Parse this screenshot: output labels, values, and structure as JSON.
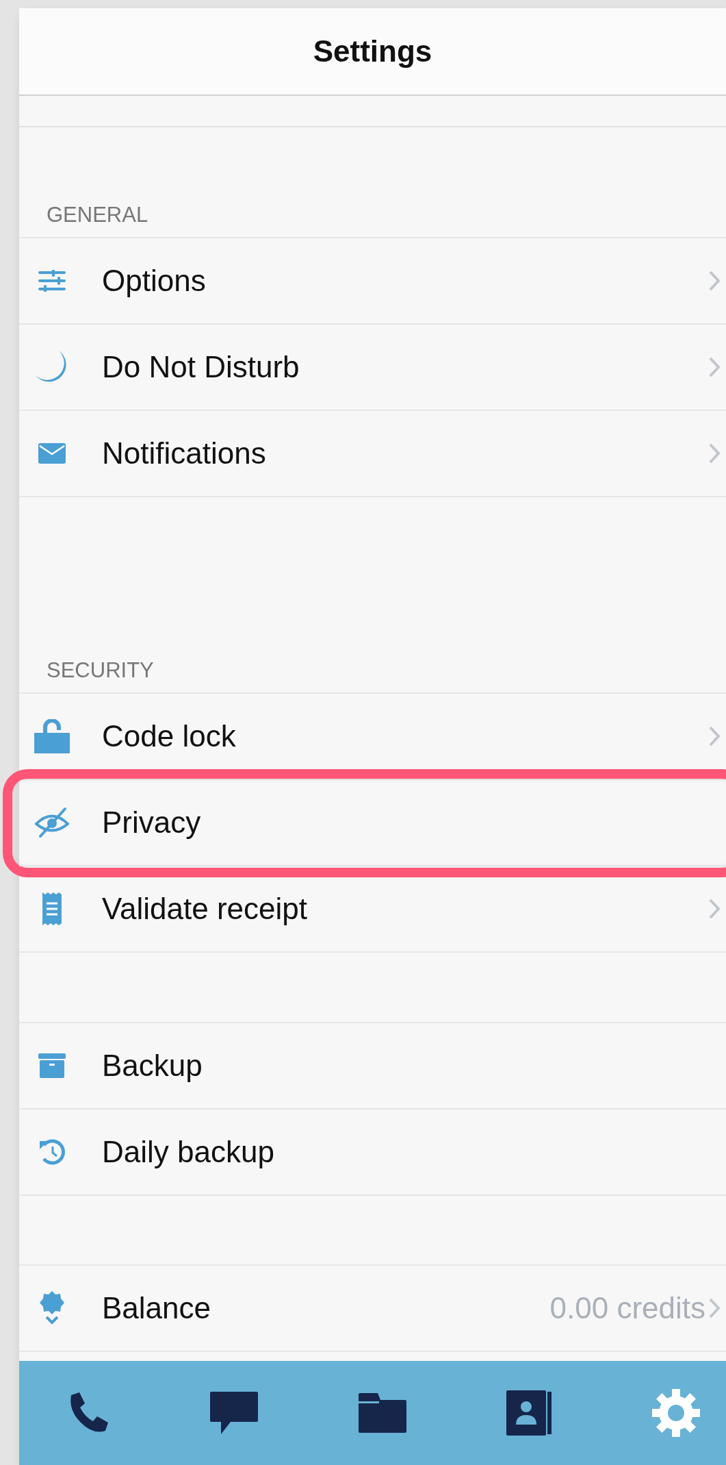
{
  "header": {
    "title": "Settings"
  },
  "groups": [
    {
      "title": "GENERAL",
      "rows": [
        {
          "label": "Options",
          "kind": "sliders",
          "chevron": true,
          "highlighted": false
        },
        {
          "label": "Do Not Disturb",
          "kind": "moon",
          "chevron": true,
          "highlighted": false
        },
        {
          "label": "Notifications",
          "kind": "envelope",
          "chevron": true,
          "highlighted": false
        }
      ]
    },
    {
      "title": "SECURITY",
      "rows": [
        {
          "label": "Code lock",
          "kind": "lock",
          "chevron": true,
          "highlighted": false
        },
        {
          "label": "Privacy",
          "kind": "eye-slash",
          "chevron": false,
          "highlighted": true
        },
        {
          "label": "Validate receipt",
          "kind": "receipt",
          "chevron": true,
          "highlighted": false
        }
      ]
    },
    {
      "rows": [
        {
          "label": "Backup",
          "kind": "box",
          "chevron": false,
          "highlighted": false
        },
        {
          "label": "Daily backup",
          "kind": "history",
          "chevron": false,
          "highlighted": false
        }
      ]
    },
    {
      "rows": [
        {
          "label": "Balance",
          "kind": "badge",
          "value": "0.00 credits",
          "chevron": true,
          "highlighted": false
        }
      ]
    }
  ],
  "tab_bar": [
    {
      "kind": "phone",
      "selected": false
    },
    {
      "kind": "chat",
      "selected": false
    },
    {
      "kind": "folder",
      "selected": false
    },
    {
      "kind": "contacts",
      "selected": false
    },
    {
      "kind": "settings",
      "selected": true
    }
  ]
}
